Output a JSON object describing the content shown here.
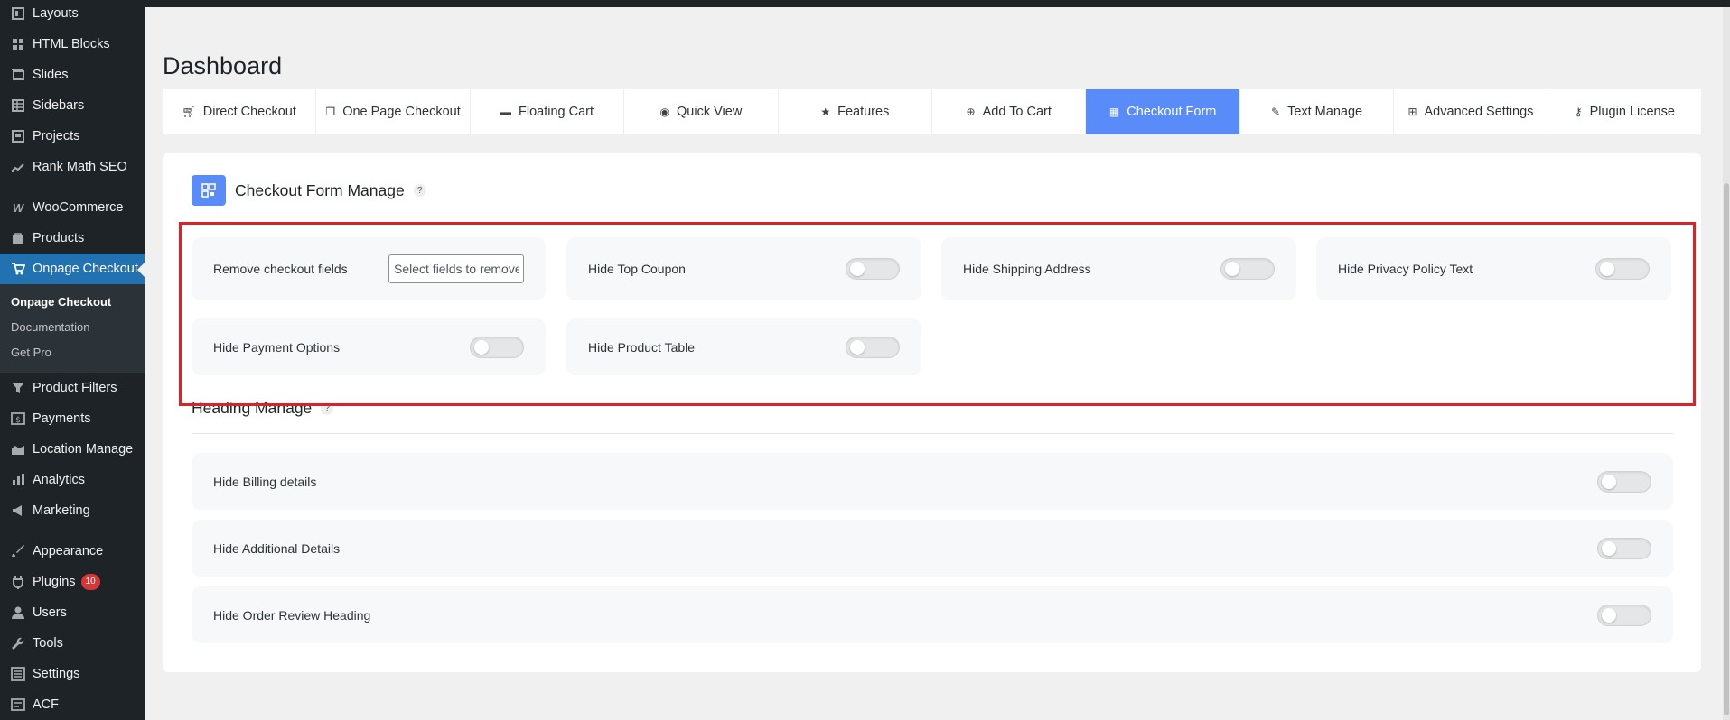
{
  "sidebar": {
    "items": [
      {
        "label": "Layouts",
        "icon": "layouts-icon"
      },
      {
        "label": "HTML Blocks",
        "icon": "html-blocks-icon"
      },
      {
        "label": "Slides",
        "icon": "slides-icon"
      },
      {
        "label": "Sidebars",
        "icon": "sidebars-icon"
      },
      {
        "label": "Projects",
        "icon": "projects-icon"
      },
      {
        "label": "Rank Math SEO",
        "icon": "rank-math-icon"
      },
      {
        "label": "WooCommerce",
        "icon": "woocommerce-icon"
      },
      {
        "label": "Products",
        "icon": "products-icon"
      },
      {
        "label": "Onpage Checkout",
        "icon": "cart-icon"
      },
      {
        "label": "Product Filters",
        "icon": "filter-icon"
      },
      {
        "label": "Payments",
        "icon": "payments-icon"
      },
      {
        "label": "Location Manage",
        "icon": "location-icon"
      },
      {
        "label": "Analytics",
        "icon": "analytics-icon"
      },
      {
        "label": "Marketing",
        "icon": "marketing-icon"
      },
      {
        "label": "Appearance",
        "icon": "appearance-icon"
      },
      {
        "label": "Plugins",
        "icon": "plugins-icon",
        "badge": "10"
      },
      {
        "label": "Users",
        "icon": "users-icon"
      },
      {
        "label": "Tools",
        "icon": "tools-icon"
      },
      {
        "label": "Settings",
        "icon": "settings-icon"
      },
      {
        "label": "ACF",
        "icon": "acf-icon"
      }
    ],
    "submenu": [
      "Onpage Checkout",
      "Documentation",
      "Get Pro"
    ]
  },
  "page": {
    "title": "Dashboard"
  },
  "tabs": [
    {
      "label": "Direct Checkout",
      "icon": "cart-icon"
    },
    {
      "label": "One Page Checkout",
      "icon": "copy-icon"
    },
    {
      "label": "Floating Cart",
      "icon": "cart-box-icon"
    },
    {
      "label": "Quick View",
      "icon": "eye-icon"
    },
    {
      "label": "Features",
      "icon": "star-icon"
    },
    {
      "label": "Add To Cart",
      "icon": "plus-circle-icon"
    },
    {
      "label": "Checkout Form",
      "icon": "form-icon",
      "active": true
    },
    {
      "label": "Text Manage",
      "icon": "pencil-icon"
    },
    {
      "label": "Advanced Settings",
      "icon": "sliders-icon"
    },
    {
      "label": "Plugin License",
      "icon": "key-icon"
    }
  ],
  "checkout_form": {
    "title": "Checkout Form Manage",
    "help": "?",
    "remove_fields_label": "Remove checkout fields",
    "remove_fields_placeholder": "Select fields to remove",
    "toggles": [
      {
        "label": "Hide Top Coupon",
        "on": false
      },
      {
        "label": "Hide Shipping Address",
        "on": false
      },
      {
        "label": "Hide Privacy Policy Text",
        "on": false
      },
      {
        "label": "Hide Payment Options",
        "on": false
      },
      {
        "label": "Hide Product Table",
        "on": false
      }
    ]
  },
  "heading_manage": {
    "title": "Heading Manage",
    "help": "?",
    "toggles": [
      {
        "label": "Hide Billing details",
        "on": false
      },
      {
        "label": "Hide Additional Details",
        "on": false
      },
      {
        "label": "Hide Order Review Heading",
        "on": false
      }
    ]
  },
  "colors": {
    "accent": "#5a8cf9",
    "wp_blue": "#2271b1",
    "highlight": "#d9222a",
    "sidebar": "#1d2327"
  }
}
